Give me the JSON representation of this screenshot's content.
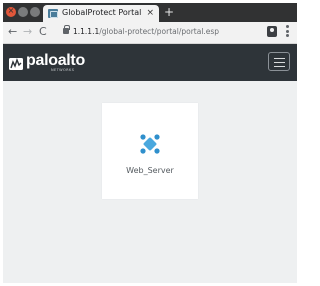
{
  "window": {
    "controls": [
      "close",
      "minimize",
      "maximize"
    ],
    "close_glyph": "×"
  },
  "tab": {
    "title": "GlobalProtect Portal",
    "close_glyph": "×",
    "new_tab_glyph": "+"
  },
  "toolbar": {
    "back_glyph": "←",
    "forward_glyph": "→",
    "reload_glyph": "C",
    "url_host": "1.1.1.1",
    "url_path": "/global-protect/portal/portal.esp"
  },
  "header": {
    "logo_text": "paloalto",
    "logo_subtext": "NETWORKS",
    "menu_icon": "hamburger-menu-icon"
  },
  "apps": [
    {
      "label": "Web_Server",
      "icon": "server-app-icon"
    }
  ],
  "colors": {
    "header_bg": "#2e3439",
    "page_bg": "#eef0f1",
    "card_bg": "#ffffff",
    "icon_accent": "#4aa8de"
  }
}
